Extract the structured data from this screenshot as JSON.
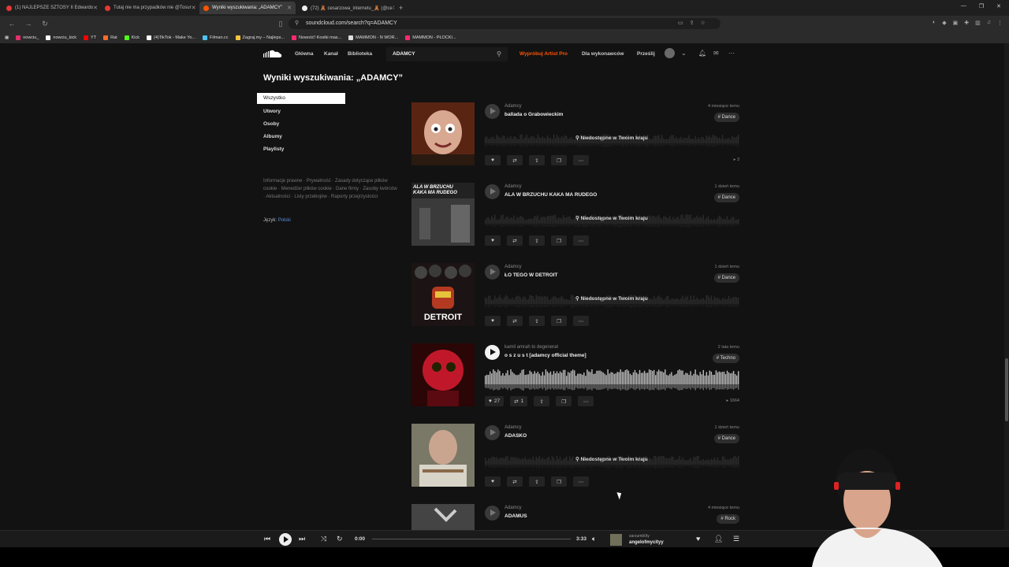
{
  "browser": {
    "tabs": [
      {
        "label": "(1) NAJLEPSZE SZTOSY II Edwardo",
        "color": "#e53935",
        "active": false
      },
      {
        "label": "Tutaj nie ma przypadków nie @Tosur",
        "color": "#e53935",
        "active": false
      },
      {
        "label": "Wyniki wyszukiwania: „ADAMCY”",
        "color": "#ff5500",
        "active": true
      },
      {
        "label": "(72) 🧸 cesarzowa_internetu_🧸 (@ce",
        "color": "#eeeeee",
        "active": false
      }
    ],
    "new_tab": "+",
    "url": "soundcloud.com/search?q=ADAMCY",
    "bookmarks": [
      {
        "label": "nowciu_",
        "color": "#e1306c"
      },
      {
        "label": "nowciu_kick",
        "color": "#ffffff"
      },
      {
        "label": "YT",
        "color": "#ff0000"
      },
      {
        "label": "Rat",
        "color": "#ff6b2b"
      },
      {
        "label": "Kick",
        "color": "#53fc18"
      },
      {
        "label": "(4)TikTok - Make Yo...",
        "color": "#ffffff"
      },
      {
        "label": "Filman.cc",
        "color": "#4fc3f7"
      },
      {
        "label": "Zagraj.my – Najleps...",
        "color": "#f5c542"
      },
      {
        "label": "Nowość! Kostki mas...",
        "color": "#ff2a6d"
      },
      {
        "label": "MAMMON - N WOR...",
        "color": "#dddddd"
      },
      {
        "label": "MAMMON - PŁOCKI...",
        "color": "#ff2a6d"
      }
    ]
  },
  "header": {
    "nav": [
      "Główna",
      "Kanał",
      "Biblioteka"
    ],
    "search_value": "ADAMCY",
    "artist_pro": "Wypróbuj Artist Pro",
    "for_artists": "Dla wykonawców",
    "upload": "Prześlij",
    "accent": "#ff5500"
  },
  "search": {
    "heading": "Wyniki wyszukiwania: „ADAMCY”",
    "filters": [
      "Wszystko",
      "Utwory",
      "Osoby",
      "Albumy",
      "Playlisty"
    ],
    "active_filter": "Wszystko"
  },
  "sidebar": {
    "legal": "Informacje prawne · Prywatność · Zasady dotyczące plików cookie · Menedżer plików cookie · Dane firmy · Zasoby twórców · Aktualności · Listy przebojów · Raporty przejrzystości",
    "language_label": "Język:",
    "language_value": "Polski"
  },
  "tracks": [
    {
      "artist": "Adamcy",
      "title": "ballada o Grabowieckim",
      "time": "4 miesiące temu",
      "tag": "# Dance",
      "unavailable": "Niedostępne w Twoim kraju",
      "likes": "",
      "reposts": "",
      "plays": "3"
    },
    {
      "artist": "Adamcy",
      "title": "ALA W BRZUCHU KAKA MA RUDEGO",
      "time": "1 dzień temu",
      "tag": "# Dance",
      "unavailable": "Niedostępne w Twoim kraju",
      "likes": "",
      "reposts": "",
      "plays": "",
      "art_text": "ALA W BRZUCHU KAKA MA RUDEGO"
    },
    {
      "artist": "Adamcy",
      "title": "ŁO TEGO W DETROIT",
      "time": "1 dzień temu",
      "tag": "# Dance",
      "unavailable": "Niedostępne w Twoim kraju",
      "likes": "",
      "reposts": "",
      "plays": "",
      "art_text": "DETROIT"
    },
    {
      "artist": "kamil amrah to degenerat",
      "title": "o s z u s t [adamcy official theme]",
      "time": "2 lata temu",
      "tag": "# Techno",
      "unavailable": "",
      "likes": "27",
      "reposts": "1",
      "plays": "1664"
    },
    {
      "artist": "Adamcy",
      "title": "ADASKO",
      "time": "1 dzień temu",
      "tag": "# Dance",
      "unavailable": "Niedostępne w Twoim kraju",
      "likes": "",
      "reposts": "",
      "plays": ""
    },
    {
      "artist": "Adamcy",
      "title": "ADAMUS",
      "time": "4 miesiące temu",
      "tag": "# Rock",
      "unavailable": "",
      "likes": "",
      "reposts": "",
      "plays": ""
    }
  ],
  "player": {
    "current_time": "0:00",
    "duration": "3:33",
    "uploader": "sarzumb0ty",
    "track": "angelofmycityy",
    "progress_fraction": 0
  }
}
